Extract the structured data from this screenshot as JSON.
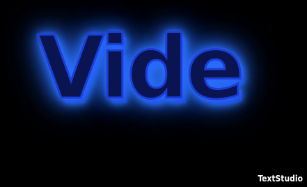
{
  "art": {
    "word": "Vide",
    "fill_color": "#0a1450",
    "glow_color": "#2a6bff",
    "background_color": "#000000"
  },
  "watermark": {
    "text": "TextStudio"
  }
}
